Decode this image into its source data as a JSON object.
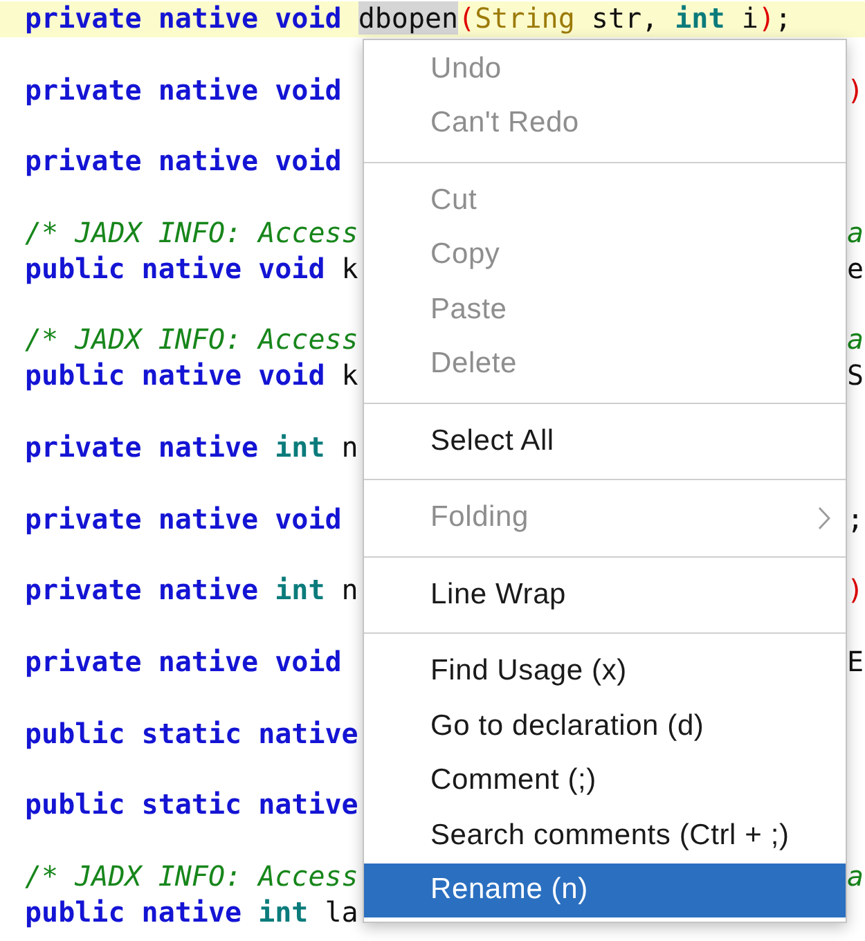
{
  "code_blocks": [
    {
      "lines": [
        {
          "highlighted": true,
          "tokens": [
            {
              "kind": "keyword",
              "text": "private native void "
            },
            {
              "kind": "highlight",
              "text": "dbopen"
            },
            {
              "kind": "paren",
              "text": "("
            },
            {
              "kind": "class",
              "text": "String"
            },
            {
              "kind": "name",
              "text": " str, "
            },
            {
              "kind": "type",
              "text": "int"
            },
            {
              "kind": "name",
              "text": " i"
            },
            {
              "kind": "paren",
              "text": ")"
            },
            {
              "kind": "punct",
              "text": ";"
            }
          ]
        }
      ]
    },
    {
      "lines": [
        {
          "highlighted": false,
          "tokens": [
            {
              "kind": "keyword",
              "text": "private native void"
            }
          ],
          "tail": [
            {
              "kind": "paren",
              "text": ")"
            }
          ]
        }
      ]
    },
    {
      "lines": [
        {
          "highlighted": false,
          "tokens": [
            {
              "kind": "keyword",
              "text": "private native void"
            }
          ]
        }
      ]
    },
    {
      "lines": [
        {
          "highlighted": false,
          "tokens": [
            {
              "kind": "comment",
              "text": "/* JADX INFO: Access"
            }
          ],
          "tail": [
            {
              "kind": "comment",
              "text": "a"
            }
          ]
        },
        {
          "highlighted": false,
          "tokens": [
            {
              "kind": "keyword",
              "text": "public native void"
            },
            {
              "kind": "name",
              "text": " k"
            }
          ],
          "tail": [
            {
              "kind": "name",
              "text": "e"
            }
          ]
        }
      ]
    },
    {
      "lines": [
        {
          "highlighted": false,
          "tokens": [
            {
              "kind": "comment",
              "text": "/* JADX INFO: Access"
            }
          ],
          "tail": [
            {
              "kind": "comment",
              "text": "a"
            }
          ]
        },
        {
          "highlighted": false,
          "tokens": [
            {
              "kind": "keyword",
              "text": "public native void"
            },
            {
              "kind": "name",
              "text": " k"
            }
          ],
          "tail": [
            {
              "kind": "name",
              "text": "S"
            }
          ]
        }
      ]
    },
    {
      "lines": [
        {
          "highlighted": false,
          "tokens": [
            {
              "kind": "keyword",
              "text": "private native"
            },
            {
              "kind": "type",
              "text": " int"
            },
            {
              "kind": "name",
              "text": " n"
            }
          ]
        }
      ]
    },
    {
      "lines": [
        {
          "highlighted": false,
          "tokens": [
            {
              "kind": "keyword",
              "text": "private native void"
            }
          ],
          "tail": [
            {
              "kind": "punct",
              "text": ";"
            }
          ]
        }
      ]
    },
    {
      "lines": [
        {
          "highlighted": false,
          "tokens": [
            {
              "kind": "keyword",
              "text": "private native"
            },
            {
              "kind": "type",
              "text": " int"
            },
            {
              "kind": "name",
              "text": " n"
            }
          ],
          "tail": [
            {
              "kind": "paren",
              "text": ")"
            }
          ]
        }
      ]
    },
    {
      "lines": [
        {
          "highlighted": false,
          "tokens": [
            {
              "kind": "keyword",
              "text": "private native void"
            }
          ],
          "tail": [
            {
              "kind": "name",
              "text": "E"
            }
          ]
        }
      ]
    },
    {
      "lines": [
        {
          "highlighted": false,
          "tokens": [
            {
              "kind": "keyword",
              "text": "public static native"
            }
          ]
        }
      ]
    },
    {
      "lines": [
        {
          "highlighted": false,
          "tokens": [
            {
              "kind": "keyword",
              "text": "public static native"
            }
          ]
        }
      ]
    },
    {
      "lines": [
        {
          "highlighted": false,
          "tokens": [
            {
              "kind": "comment",
              "text": "/* JADX INFO: Access"
            }
          ],
          "tail": [
            {
              "kind": "comment",
              "text": "a"
            }
          ]
        },
        {
          "highlighted": false,
          "tokens": [
            {
              "kind": "keyword",
              "text": "public native"
            },
            {
              "kind": "type",
              "text": " int"
            },
            {
              "kind": "name",
              "text": " la"
            }
          ]
        }
      ]
    }
  ],
  "context_menu": {
    "groups": [
      {
        "items": [
          {
            "label": "Undo",
            "disabled": true,
            "selected": false,
            "submenu": false
          },
          {
            "label": "Can't Redo",
            "disabled": true,
            "selected": false,
            "submenu": false
          }
        ]
      },
      {
        "items": [
          {
            "label": "Cut",
            "disabled": true,
            "selected": false,
            "submenu": false
          },
          {
            "label": "Copy",
            "disabled": true,
            "selected": false,
            "submenu": false
          },
          {
            "label": "Paste",
            "disabled": true,
            "selected": false,
            "submenu": false
          },
          {
            "label": "Delete",
            "disabled": true,
            "selected": false,
            "submenu": false
          }
        ]
      },
      {
        "items": [
          {
            "label": "Select All",
            "disabled": false,
            "selected": false,
            "submenu": false
          }
        ]
      },
      {
        "items": [
          {
            "label": "Folding",
            "disabled": true,
            "selected": false,
            "submenu": true
          }
        ]
      },
      {
        "items": [
          {
            "label": "Line Wrap",
            "disabled": false,
            "selected": false,
            "submenu": false
          }
        ]
      },
      {
        "items": [
          {
            "label": "Find Usage (x)",
            "disabled": false,
            "selected": false,
            "submenu": false
          },
          {
            "label": "Go to declaration (d)",
            "disabled": false,
            "selected": false,
            "submenu": false
          },
          {
            "label": "Comment (;)",
            "disabled": false,
            "selected": false,
            "submenu": false
          },
          {
            "label": "Search comments (Ctrl + ;)",
            "disabled": false,
            "selected": false,
            "submenu": false
          },
          {
            "label": "Rename (n)",
            "disabled": false,
            "selected": true,
            "submenu": false
          }
        ]
      }
    ]
  }
}
